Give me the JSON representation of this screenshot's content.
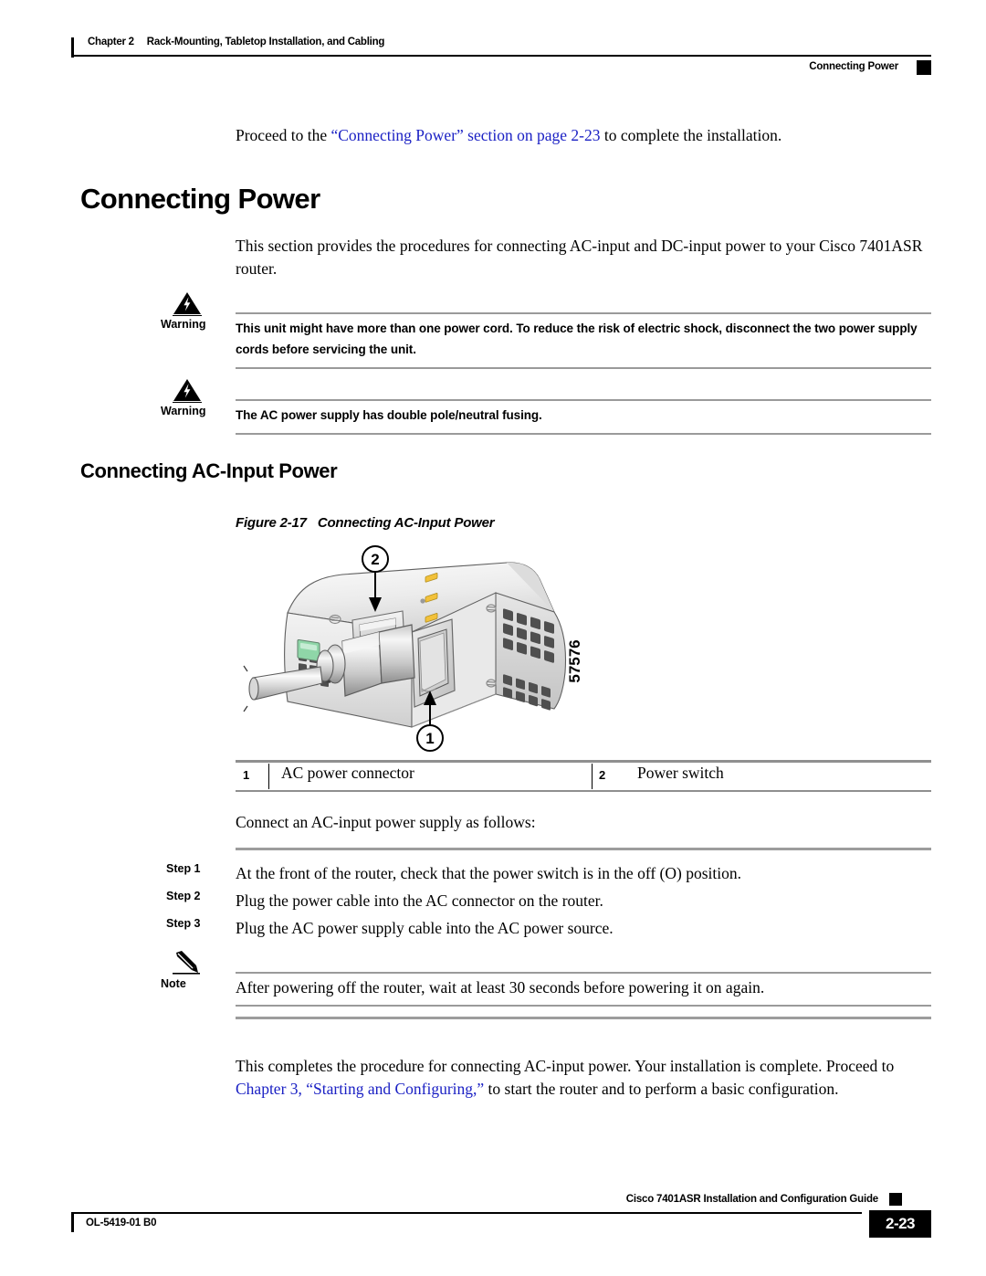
{
  "header": {
    "chapter_num": "Chapter 2",
    "chapter_title": "Rack-Mounting, Tabletop Installation, and Cabling",
    "section": "Connecting Power"
  },
  "intro": {
    "before_link": "Proceed to the ",
    "link": "“Connecting Power” section on page 2-23",
    "after_link": " to complete the installation."
  },
  "section": {
    "title": "Connecting Power",
    "paragraph": "This section provides the procedures for connecting AC-input and DC-input power to your Cisco 7401ASR router."
  },
  "warnings": [
    {
      "label": "Warning",
      "icon": "warning-triangle-icon",
      "text": "This unit might have more than one power cord. To reduce the risk of electric shock, disconnect the two power supply cords before servicing the unit."
    },
    {
      "label": "Warning",
      "icon": "warning-triangle-icon",
      "text": "The AC power supply has double pole/neutral fusing."
    }
  ],
  "subsection": {
    "title": "Connecting AC-Input Power"
  },
  "figure": {
    "number": "Figure 2-17",
    "title": "Connecting AC-Input Power",
    "artwork_number": "57576",
    "callouts": [
      {
        "id": "1",
        "target": "ac-power-connector"
      },
      {
        "id": "2",
        "target": "power-switch"
      }
    ],
    "legend": [
      {
        "num": "1",
        "text": "AC power connector"
      },
      {
        "num": "2",
        "text": "Power switch"
      }
    ]
  },
  "procedure": {
    "lead_in": "Connect an AC-input power supply as follows:",
    "steps": [
      {
        "label": "Step 1",
        "text": "At the front of the router, check that the power switch is in the off (O) position."
      },
      {
        "label": "Step 2",
        "text": "Plug the power cable into the AC connector on the router."
      },
      {
        "label": "Step 3",
        "text": "Plug the AC power supply cable into the AC power source."
      }
    ]
  },
  "note": {
    "label": "Note",
    "icon": "pencil-icon",
    "text": "After powering off the router, wait at least 30 seconds before powering it on again."
  },
  "closing": {
    "before_link": "This completes the procedure for connecting AC-input power. Your installation is complete. Proceed to ",
    "link": "Chapter 3, “Starting and Configuring,”",
    "after_link": " to start the router and to perform a basic configuration."
  },
  "footer": {
    "doc_id": "OL-5419-01 B0",
    "guide_title": "Cisco 7401ASR Installation and Configuration Guide",
    "page_number": "2-23"
  },
  "colors": {
    "link": "#1b21c4",
    "rule_grey": "#9a9a9a",
    "chassis_light": "#e8e8e8",
    "chassis_mid": "#c9c9c9",
    "chassis_dark": "#8d8d8d",
    "led_green": "#8fd6a8",
    "pin_gold": "#f2c13a"
  }
}
